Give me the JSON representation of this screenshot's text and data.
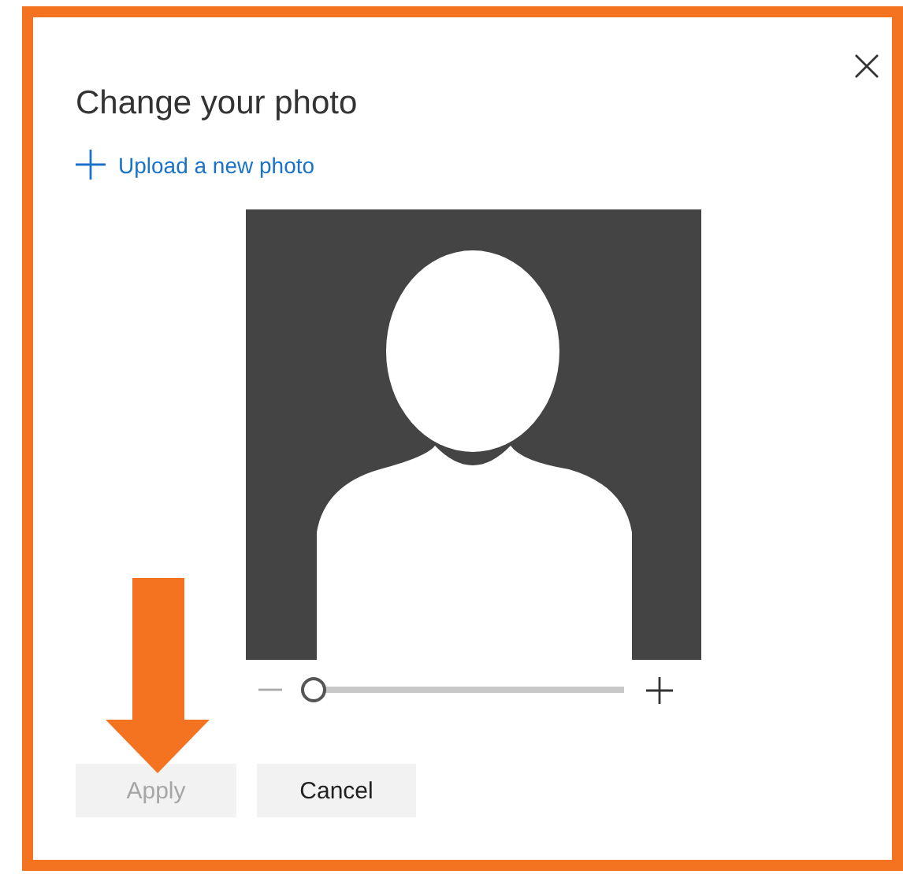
{
  "dialog": {
    "title": "Change your photo",
    "upload_link": {
      "label": "Upload a new photo"
    },
    "zoom_slider": {
      "level": 0.04
    },
    "buttons": [
      {
        "label": "Apply",
        "disabled": true
      },
      {
        "label": "Cancel",
        "disabled": false
      }
    ]
  }
}
